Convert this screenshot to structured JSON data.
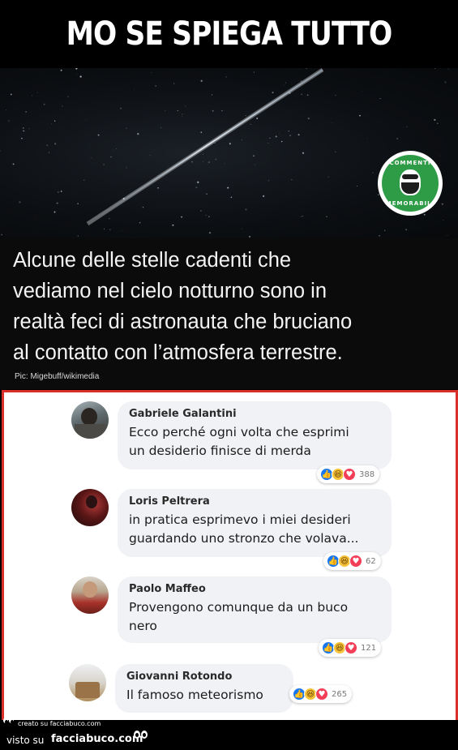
{
  "meme": {
    "headline": "MO SE SPIEGA TUTTO",
    "caption_lines": [
      "Alcune delle stelle cadenti che",
      "vediamo nel cielo notturno sono in",
      "realtà feci di astronauta che bruciano",
      "al contatto con l’atmosfera terrestre."
    ],
    "credit": "Pic: Migebuff/wikimedia",
    "badge_top": "COMMENTI",
    "badge_bottom": "MEMORABILI",
    "badge_color": "#2e9b46"
  },
  "comments": [
    {
      "author": "Gabriele  Galantini",
      "lines": [
        "Ecco perché ogni volta che esprimi",
        "un desiderio finisce di merda"
      ],
      "reaction_count": "388"
    },
    {
      "author": "Loris Peltrera",
      "lines": [
        "in pratica esprimevo i miei desideri",
        "guardando uno stronzo che volava..."
      ],
      "reaction_count": "62"
    },
    {
      "author": "Paolo Maffeo",
      "lines": [
        "Provengono comunque da un buco",
        "nero"
      ],
      "reaction_count": "121"
    },
    {
      "author": "Giovanni Rotondo",
      "lines": [
        "Il famoso meteorismo"
      ],
      "reaction_count": "265"
    }
  ],
  "footer": {
    "small_text": "creato su facciabuco.com",
    "visto_su": "visto su",
    "site": "facciabuco.com"
  },
  "colors": {
    "frame": "#d9302a",
    "bubble": "#f0f2f5",
    "like": "#1877f2",
    "haha": "#f7c33a",
    "love": "#f33e58"
  }
}
